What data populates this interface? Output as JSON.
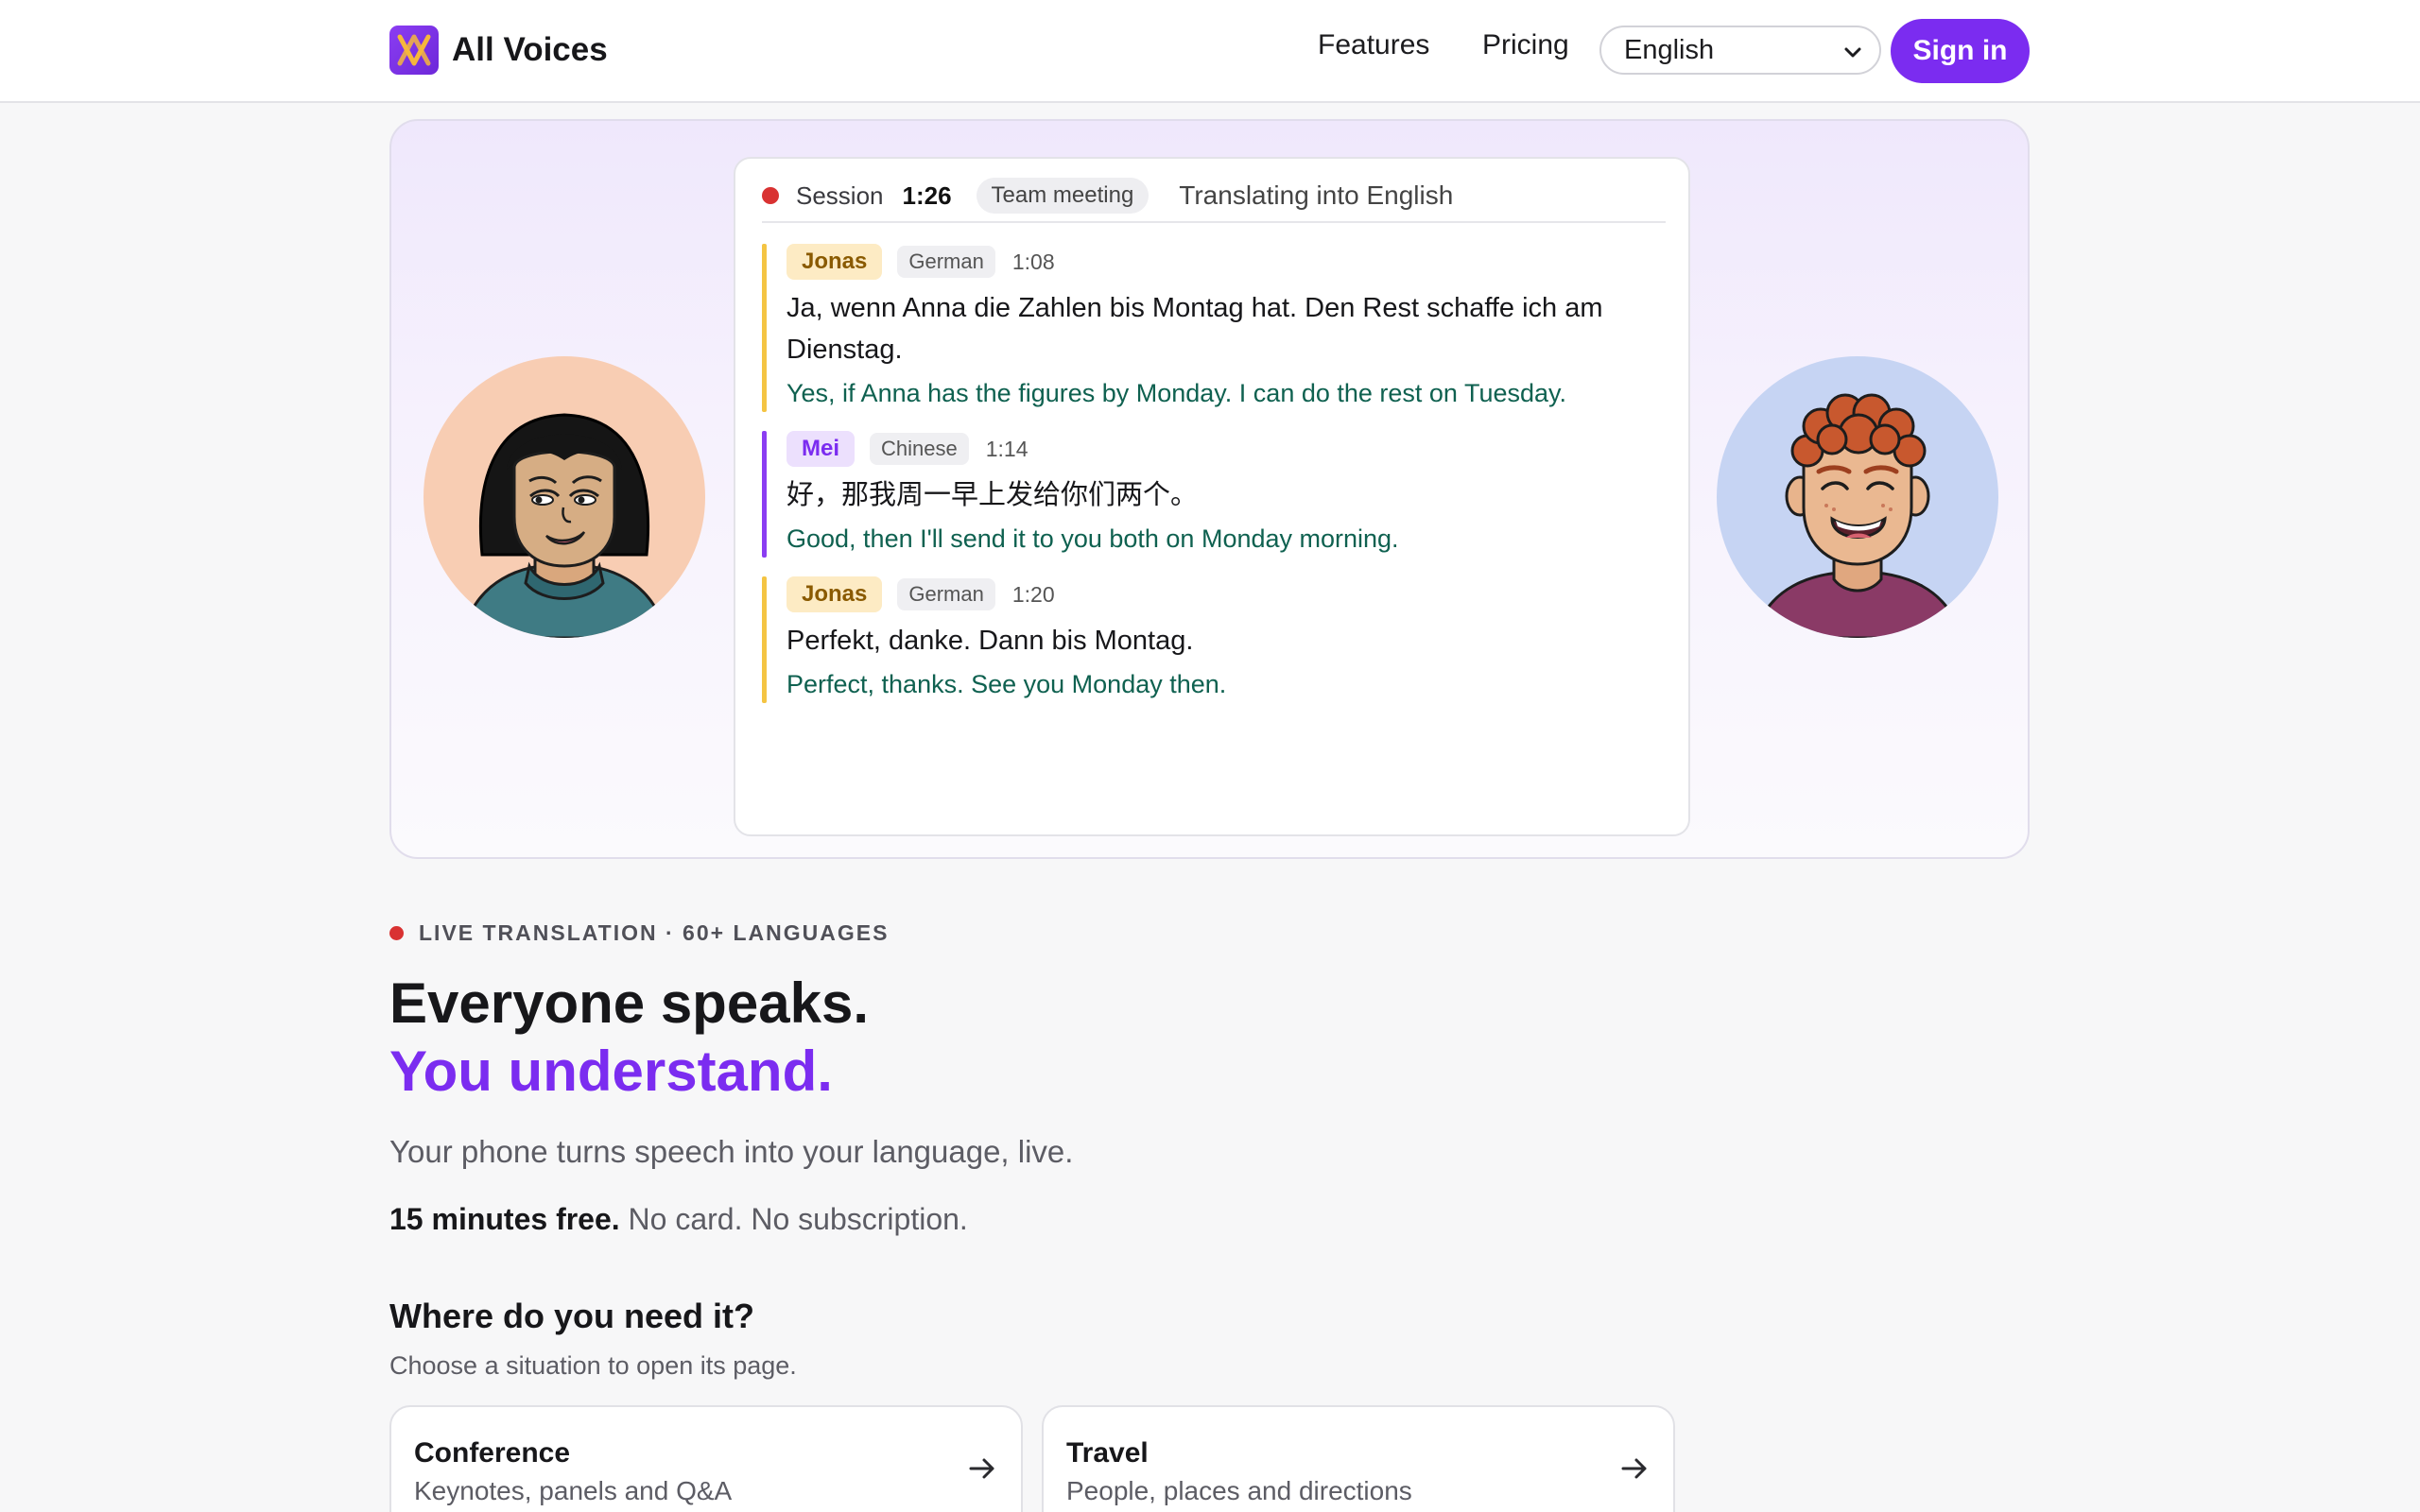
{
  "header": {
    "brand_name": "All Voices",
    "nav": {
      "features": "Features",
      "pricing": "Pricing"
    },
    "language_select": {
      "selected": "English"
    },
    "sign_in": "Sign in"
  },
  "transcript": {
    "session_label": "Session",
    "session_time": "1:26",
    "session_tag": "Team meeting",
    "target": "Translating into English",
    "messages": [
      {
        "speaker": "Jonas",
        "language": "German",
        "time": "1:08",
        "original": "Ja, wenn Anna die Zahlen bis Montag hat. Den Rest schaffe ich am Dienstag.",
        "translated": "Yes, if Anna has the figures by Monday. I can do the rest on Tuesday."
      },
      {
        "speaker": "Mei",
        "language": "Chinese",
        "time": "1:14",
        "original": "好，那我周一早上发给你们两个。",
        "translated": "Good, then I'll send it to you both on Monday morning."
      },
      {
        "speaker": "Jonas",
        "language": "German",
        "time": "1:20",
        "original": "Perfekt, danke. Dann bis Montag.",
        "translated": "Perfect, thanks. See you Monday then."
      }
    ]
  },
  "hero_copy": {
    "eyebrow": "LIVE TRANSLATION · 60+ LANGUAGES",
    "headline_line1": "Everyone speaks.",
    "headline_line2": "You understand.",
    "subline": "Your phone turns speech into your language, live.",
    "free_bold": "15 minutes free.",
    "free_rest": " No card. No subscription."
  },
  "situations": {
    "title": "Where do you need it?",
    "subtitle": "Choose a situation to open its page.",
    "cards": [
      {
        "title": "Conference",
        "desc": "Keynotes, panels and Q&A"
      },
      {
        "title": "Travel",
        "desc": "People, places and directions"
      }
    ]
  },
  "colors": {
    "brand": "#7b2cf0",
    "recording": "#d93232",
    "german_accent": "#f4c443",
    "chinese_accent": "#8b3df2",
    "translation_text": "#0f6150"
  },
  "icons": [
    "logo-mark-icon",
    "chevron-down-icon",
    "recording-dot-icon",
    "arrow-right-icon"
  ]
}
